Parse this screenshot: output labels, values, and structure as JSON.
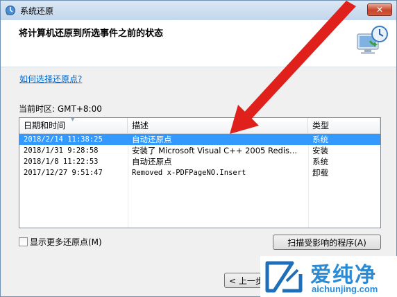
{
  "window": {
    "title": "系统还原",
    "close_label": "✕"
  },
  "header": {
    "title": "将计算机还原到所选事件之前的状态"
  },
  "help_link": "如何选择还原点?",
  "timezone": "当前时区: GMT+8:00",
  "table": {
    "columns": [
      "日期和时间",
      "描述",
      "类型"
    ],
    "rows": [
      {
        "date": "2018/2/14 11:38:25",
        "desc": "自动还原点",
        "type": "系统",
        "selected": true
      },
      {
        "date": "2018/1/31 9:28:58",
        "desc": "安装了 Microsoft Visual C++ 2005 Redis...",
        "type": "安装",
        "selected": false
      },
      {
        "date": "2018/1/8 11:22:53",
        "desc": "自动还原点",
        "type": "系统",
        "selected": false
      },
      {
        "date": "2017/12/27 9:51:47",
        "desc": "Removed x-PDFPageNO.Insert",
        "type": "卸载",
        "selected": false
      }
    ]
  },
  "show_more_label": "显示更多还原点(M)",
  "scan_button_label": "扫描受影响的程序(A)",
  "back_button_label": "< 上一步",
  "watermark": {
    "cn": "爱纯净",
    "url": "aichunjing.com"
  },
  "colors": {
    "selection": "#3399ff",
    "annotation_arrow": "#e0201b",
    "watermark": "#2a8ad4"
  }
}
